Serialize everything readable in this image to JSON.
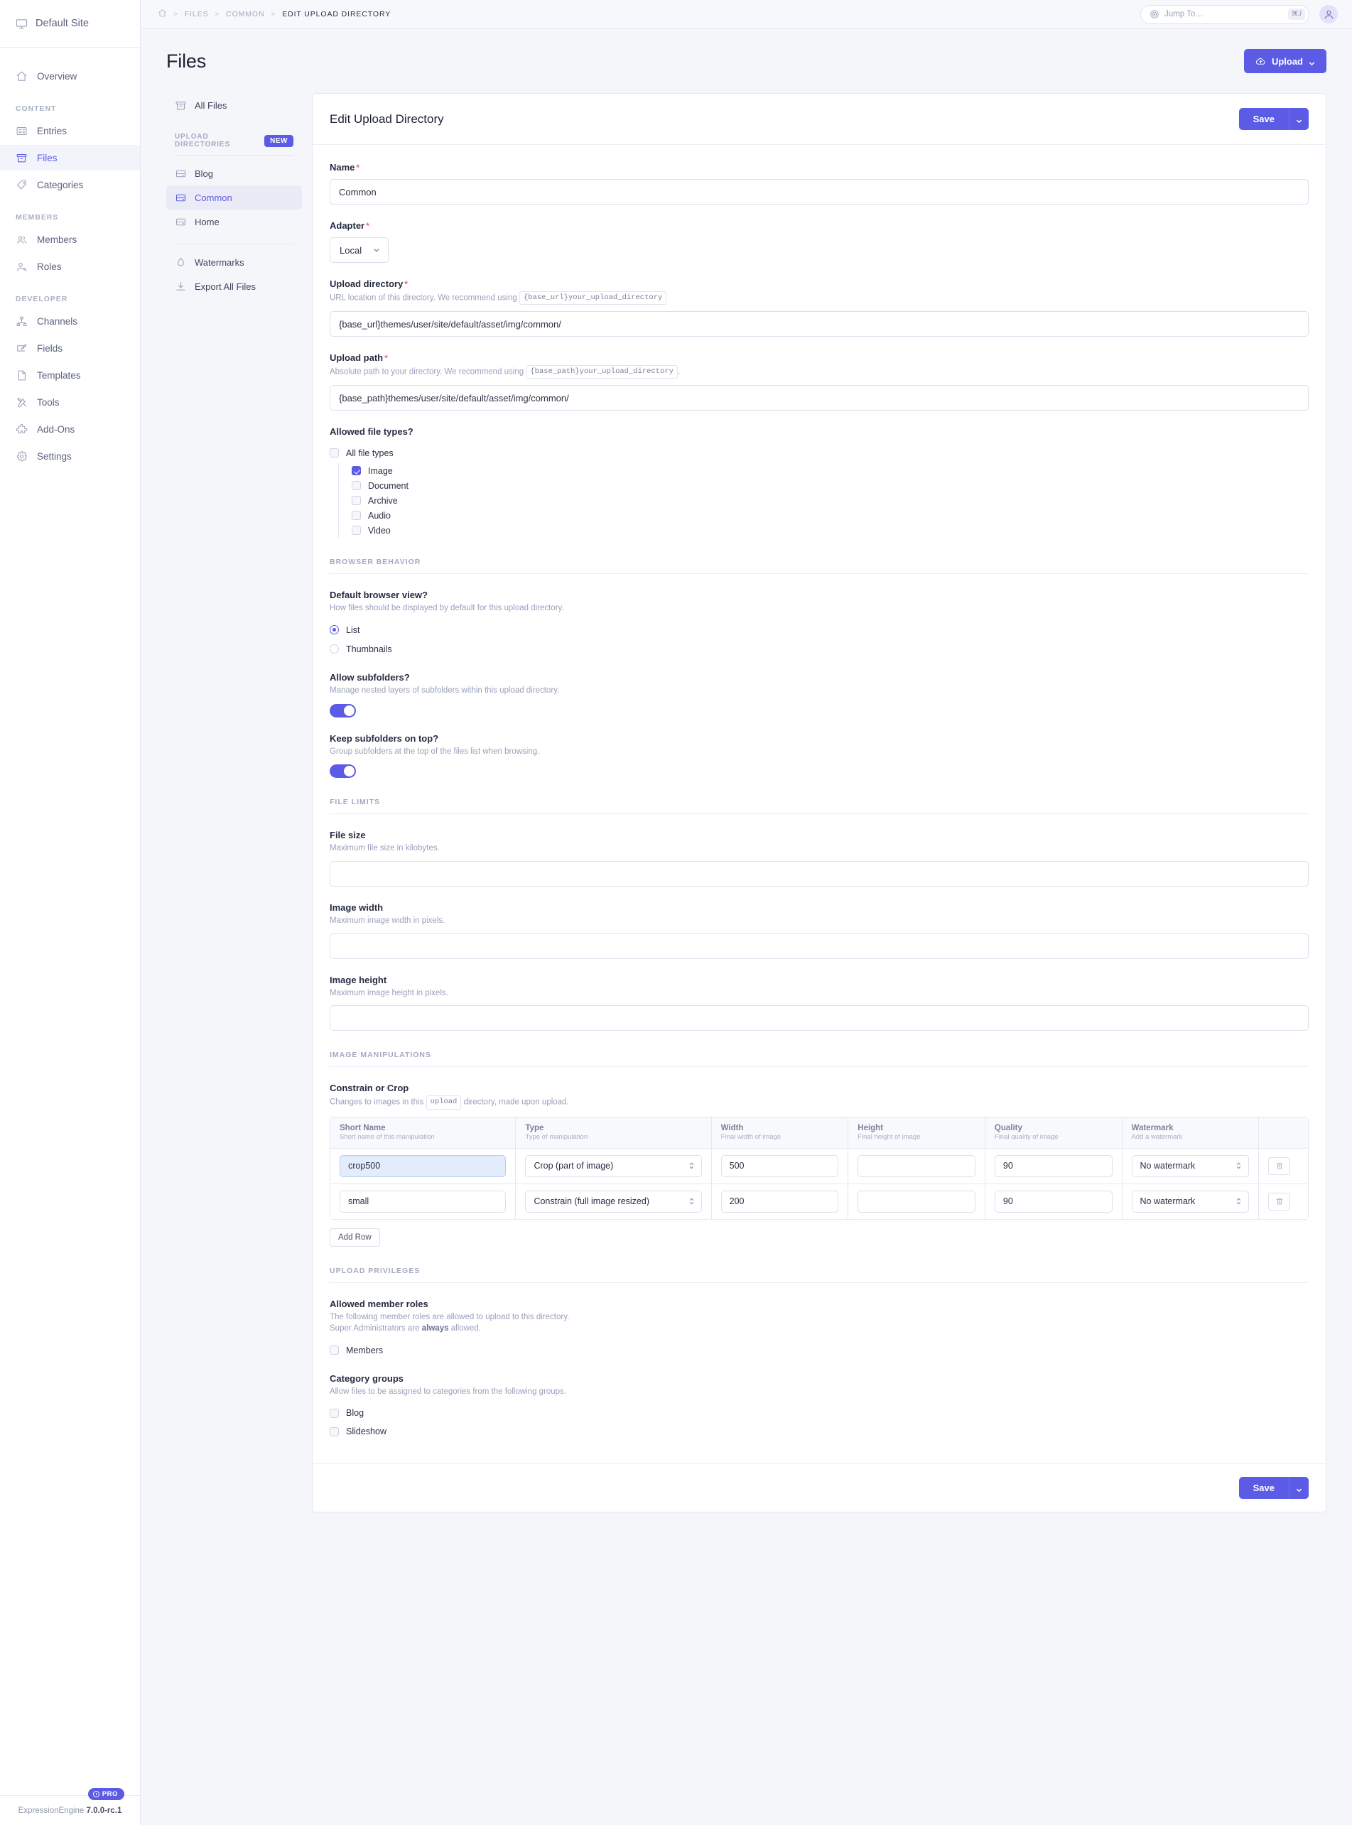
{
  "sidebar": {
    "site_name": "Default Site",
    "items": [
      {
        "label": "Overview",
        "icon": "home-icon",
        "active": false
      }
    ],
    "groups": [
      {
        "title": "CONTENT",
        "items": [
          {
            "label": "Entries",
            "icon": "entries-icon",
            "active": false
          },
          {
            "label": "Files",
            "icon": "files-icon",
            "active": true
          },
          {
            "label": "Categories",
            "icon": "tag-icon",
            "active": false
          }
        ]
      },
      {
        "title": "MEMBERS",
        "items": [
          {
            "label": "Members",
            "icon": "members-icon",
            "active": false
          },
          {
            "label": "Roles",
            "icon": "roles-icon",
            "active": false
          }
        ]
      },
      {
        "title": "DEVELOPER",
        "items": [
          {
            "label": "Channels",
            "icon": "channels-icon",
            "active": false
          },
          {
            "label": "Fields",
            "icon": "fields-icon",
            "active": false
          },
          {
            "label": "Templates",
            "icon": "templates-icon",
            "active": false
          },
          {
            "label": "Tools",
            "icon": "tools-icon",
            "active": false
          },
          {
            "label": "Add-Ons",
            "icon": "addons-icon",
            "active": false
          },
          {
            "label": "Settings",
            "icon": "gear-icon",
            "active": false
          }
        ]
      }
    ],
    "footer": {
      "pro_badge": "PRO",
      "product": "ExpressionEngine",
      "version": "7.0.0-rc.1",
      "version_prefix": "7.0.0-",
      "version_suffix": "rc.1"
    }
  },
  "topbar": {
    "breadcrumb": [
      "FILES",
      "COMMON",
      "EDIT UPLOAD DIRECTORY"
    ],
    "separator": ">",
    "jump_to": {
      "placeholder": "Jump To…",
      "value": "",
      "shortcut": "⌘J"
    }
  },
  "page": {
    "title": "Files",
    "upload_button": "Upload"
  },
  "subnav": {
    "all_files": "All Files",
    "section_title": "UPLOAD DIRECTORIES",
    "new_badge": "NEW",
    "directories": [
      {
        "label": "Blog",
        "active": false
      },
      {
        "label": "Common",
        "active": true
      },
      {
        "label": "Home",
        "active": false
      }
    ],
    "extras": [
      {
        "label": "Watermarks",
        "icon": "watermark-icon"
      },
      {
        "label": "Export All Files",
        "icon": "export-icon"
      }
    ]
  },
  "form": {
    "heading": "Edit Upload Directory",
    "save_label": "Save",
    "name": {
      "label": "Name",
      "required": true,
      "value": "Common"
    },
    "adapter": {
      "label": "Adapter",
      "required": true,
      "value": "Local"
    },
    "upload_directory": {
      "label": "Upload directory",
      "required": true,
      "hint_before": "URL location of this directory. We recommend using",
      "hint_code": "{base_url}your_upload_directory",
      "hint_after": "",
      "value": "{base_url}themes/user/site/default/asset/img/common/"
    },
    "upload_path": {
      "label": "Upload path",
      "required": true,
      "hint_before": "Absolute path to your directory. We recommend using",
      "hint_code": "{base_path}your_upload_directory",
      "hint_after": ".",
      "value": "{base_path}themes/user/site/default/asset/img/common/"
    },
    "allowed_file_types": {
      "label": "Allowed file types?",
      "all_label": "All file types",
      "all_checked": false,
      "options": [
        {
          "label": "Image",
          "checked": true
        },
        {
          "label": "Document",
          "checked": false
        },
        {
          "label": "Archive",
          "checked": false
        },
        {
          "label": "Audio",
          "checked": false
        },
        {
          "label": "Video",
          "checked": false
        }
      ]
    },
    "browser_behavior": {
      "section": "BROWSER BEHAVIOR",
      "default_view": {
        "label": "Default browser view?",
        "hint": "How files should be displayed by default for this upload directory.",
        "options": [
          {
            "label": "List",
            "selected": true
          },
          {
            "label": "Thumbnails",
            "selected": false
          }
        ]
      },
      "allow_subfolders": {
        "label": "Allow subfolders?",
        "hint": "Manage nested layers of subfolders within this upload directory.",
        "on": true
      },
      "keep_subfolders_on_top": {
        "label": "Keep subfolders on top?",
        "hint": "Group subfolders at the top of the files list when browsing.",
        "on": true
      }
    },
    "file_limits": {
      "section": "FILE LIMITS",
      "file_size": {
        "label": "File size",
        "hint": "Maximum file size in kilobytes.",
        "value": ""
      },
      "image_width": {
        "label": "Image width",
        "hint": "Maximum image width in pixels.",
        "value": ""
      },
      "image_height": {
        "label": "Image height",
        "hint": "Maximum image height in pixels.",
        "value": ""
      }
    },
    "image_manipulations": {
      "section": "IMAGE MANIPULATIONS",
      "label": "Constrain or Crop",
      "hint_before": "Changes to images in this",
      "hint_code": "upload",
      "hint_after": "directory, made upon upload.",
      "columns": [
        {
          "title": "Short Name",
          "sub": "Short name of this manipulation"
        },
        {
          "title": "Type",
          "sub": "Type of manipulation"
        },
        {
          "title": "Width",
          "sub": "Final width of image"
        },
        {
          "title": "Height",
          "sub": "Final height of image"
        },
        {
          "title": "Quality",
          "sub": "Final quality of image"
        },
        {
          "title": "Watermark",
          "sub": "Add a watermark"
        }
      ],
      "rows": [
        {
          "short_name": "crop500",
          "type": "Crop (part of image)",
          "width": "500",
          "height": "",
          "quality": "90",
          "watermark": "No watermark",
          "focused": true
        },
        {
          "short_name": "small",
          "type": "Constrain (full image resized)",
          "width": "200",
          "height": "",
          "quality": "90",
          "watermark": "No watermark",
          "focused": false
        }
      ],
      "add_row_label": "Add Row"
    },
    "upload_privileges": {
      "section": "UPLOAD PRIVILEGES",
      "allowed_member_roles": {
        "label": "Allowed member roles",
        "hint_line1": "The following member roles are allowed to upload to this directory.",
        "hint_line2_before": "Super Administrators are",
        "hint_line2_bold": "always",
        "hint_line2_after": "allowed.",
        "options": [
          {
            "label": "Members",
            "checked": false
          }
        ]
      },
      "category_groups": {
        "label": "Category groups",
        "hint": "Allow files to be assigned to categories from the following groups.",
        "options": [
          {
            "label": "Blog",
            "checked": false
          },
          {
            "label": "Slideshow",
            "checked": false
          }
        ]
      }
    }
  },
  "colors": {
    "accent": "#5b5be5",
    "required": "#f0657e",
    "focus_field": "#e3ecfa"
  }
}
